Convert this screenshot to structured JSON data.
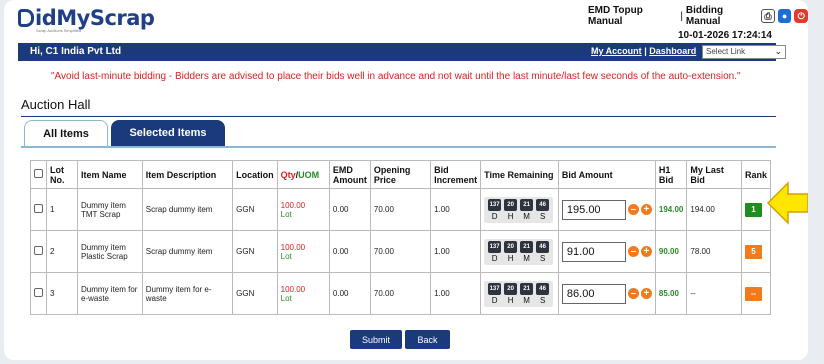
{
  "brand": {
    "name_prefix": "id",
    "name_mid": "My",
    "name_end": "Scrap",
    "tagline": "Scrap Auctions Simplified"
  },
  "top_links": {
    "emd_topup": "EMD Topup Manual",
    "separator": "|",
    "bidding_manual": "Bidding Manual"
  },
  "datetime": "10-01-2026 17:24:14",
  "navbar": {
    "greeting": "Hi, C1 India Pvt Ltd",
    "my_account": "My Account",
    "separator": "|",
    "dashboard": "Dashboard",
    "select_link": "Select Link"
  },
  "notice": "\"Avoid last-minute bidding - Bidders are advised to place their bids well in advance and not wait until the last minute/last few seconds of the auto-extension.\"",
  "hall_title": "Auction Hall",
  "tabs": {
    "all": "All Items",
    "selected": "Selected Items"
  },
  "table": {
    "headers": {
      "lot": "Lot No.",
      "item_name": "Item Name",
      "description": "Item Description",
      "location": "Location",
      "qty": "Qty",
      "qty_sep": "/",
      "uom": "UOM",
      "emd": "EMD Amount",
      "opening": "Opening Price",
      "increment": "Bid Increment",
      "time": "Time Remaining",
      "bid": "Bid Amount",
      "h1": "H1 Bid",
      "my_last": "My Last Bid",
      "rank": "Rank"
    },
    "time_labels": [
      "D",
      "H",
      "M",
      "S"
    ],
    "rows": [
      {
        "lot": "1",
        "item_name": "Dummy item TMT Scrap",
        "description": "Scrap dummy item",
        "location": "GGN",
        "qty": "100.00",
        "uom": "Lot",
        "emd": "0.00",
        "opening": "70.00",
        "increment": "1.00",
        "time": [
          "137",
          "20",
          "21",
          "46"
        ],
        "bid": "195.00",
        "h1": "194.00",
        "my_last": "194.00",
        "rank": "1",
        "rank_color": "green"
      },
      {
        "lot": "2",
        "item_name": "Dummy item Plastic Scrap",
        "description": "Scrap dummy item",
        "location": "GGN",
        "qty": "100.00",
        "uom": "Lot",
        "emd": "0.00",
        "opening": "70.00",
        "increment": "1.00",
        "time": [
          "137",
          "20",
          "21",
          "46"
        ],
        "bid": "91.00",
        "h1": "90.00",
        "my_last": "78.00",
        "rank": "5",
        "rank_color": "orange"
      },
      {
        "lot": "3",
        "item_name": "Dummy item for e-waste",
        "description": "Dummy item for e-waste",
        "location": "GGN",
        "qty": "100.00",
        "uom": "Lot",
        "emd": "0.00",
        "opening": "70.00",
        "increment": "1.00",
        "time": [
          "137",
          "20",
          "21",
          "46"
        ],
        "bid": "86.00",
        "h1": "85.00",
        "my_last": "--",
        "rank": "--",
        "rank_color": "orange"
      }
    ]
  },
  "buttons": {
    "submit": "Submit",
    "back": "Back"
  },
  "colors": {
    "navy": "#1b3a7c",
    "red": "#e02020",
    "green": "#1e8e1e",
    "orange": "#f07b1e",
    "arrow": "#ffe600"
  },
  "icons": {
    "print": "print-icon",
    "lock": "lock-icon",
    "power": "power-icon",
    "arrow": "pointer-arrow-icon"
  }
}
